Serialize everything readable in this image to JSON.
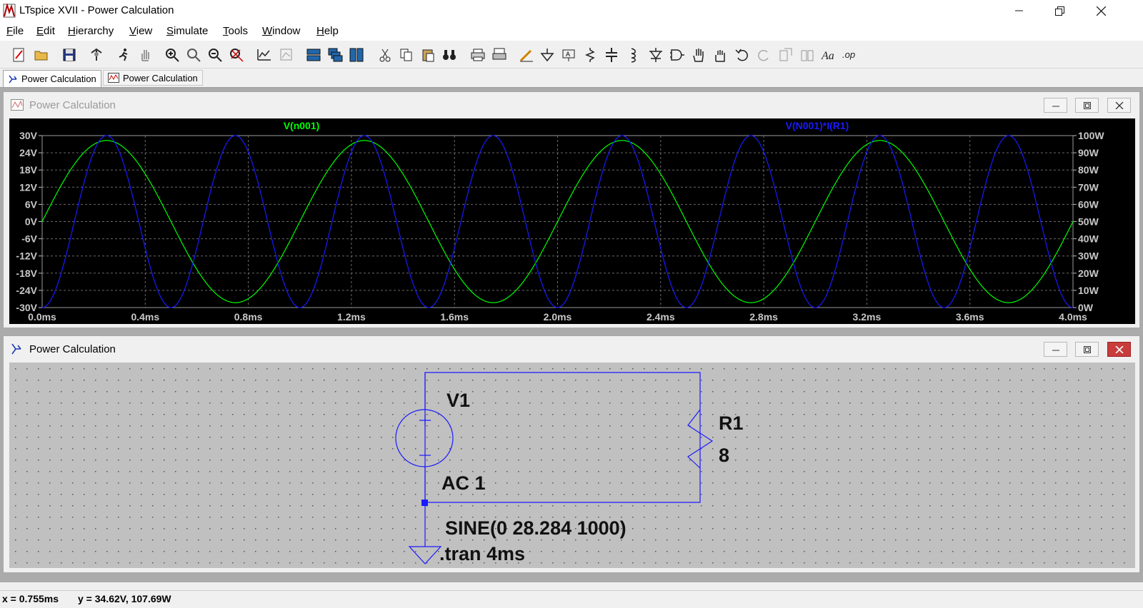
{
  "app": {
    "title": "LTspice XVII - Power Calculation"
  },
  "menu": [
    {
      "label": "File",
      "key": "F",
      "rest": "ile"
    },
    {
      "label": "Edit",
      "key": "E",
      "rest": "dit"
    },
    {
      "label": "Hierarchy",
      "key": "H",
      "rest": "ierarchy"
    },
    {
      "label": "View",
      "key": "V",
      "rest": "iew"
    },
    {
      "label": "Simulate",
      "key": "S",
      "rest": "imulate"
    },
    {
      "label": "Tools",
      "key": "T",
      "rest": "ools"
    },
    {
      "label": "Window",
      "key": "W",
      "rest": "indow"
    },
    {
      "label": "Help",
      "key": "H",
      "rest": "elp"
    }
  ],
  "tabs": [
    {
      "label": "Power Calculation",
      "icon": "schematic-icon"
    },
    {
      "label": "Power Calculation",
      "icon": "waveform-icon"
    }
  ],
  "waveform_window": {
    "title": "Power Calculation"
  },
  "schematic_window": {
    "title": "Power Calculation",
    "components": {
      "v1_name": "V1",
      "v1_value": "AC 1",
      "v1_source": "SINE(0 28.284 1000)",
      "r1_name": "R1",
      "r1_value": "8",
      "directive": ".tran 4ms"
    }
  },
  "chart_data": {
    "type": "line",
    "title": "",
    "xlabel": "",
    "ylabel": "",
    "x_ticks": [
      "0.0ms",
      "0.4ms",
      "0.8ms",
      "1.2ms",
      "1.6ms",
      "2.0ms",
      "2.4ms",
      "2.8ms",
      "3.2ms",
      "3.6ms",
      "4.0ms"
    ],
    "y_ticks_left": [
      "30V",
      "24V",
      "18V",
      "12V",
      "6V",
      "0V",
      "-6V",
      "-12V",
      "-18V",
      "-24V",
      "-30V"
    ],
    "y_ticks_right": [
      "100W",
      "90W",
      "80W",
      "70W",
      "60W",
      "50W",
      "40W",
      "30W",
      "20W",
      "10W",
      "0W"
    ],
    "xlim": [
      0,
      4
    ],
    "ylim_left": [
      -30,
      30
    ],
    "ylim_right": [
      0,
      100
    ],
    "grid": true,
    "background": "#000000",
    "series": [
      {
        "name": "V(n001)",
        "color": "#00ff00",
        "axis": "left",
        "expression": "28.284*sin(2*pi*1000*t)",
        "amplitude": 28.284,
        "frequency_hz": 1000
      },
      {
        "name": "V(N001)*I(R1)",
        "color": "#1a1aff",
        "axis": "right",
        "expression": "(28.284*sin(2*pi*1000*t))^2/8",
        "peak": 100,
        "frequency_hz": 2000
      }
    ]
  },
  "status": {
    "x": "x = 0.755ms",
    "y": "y = 34.62V, 107.69W"
  }
}
